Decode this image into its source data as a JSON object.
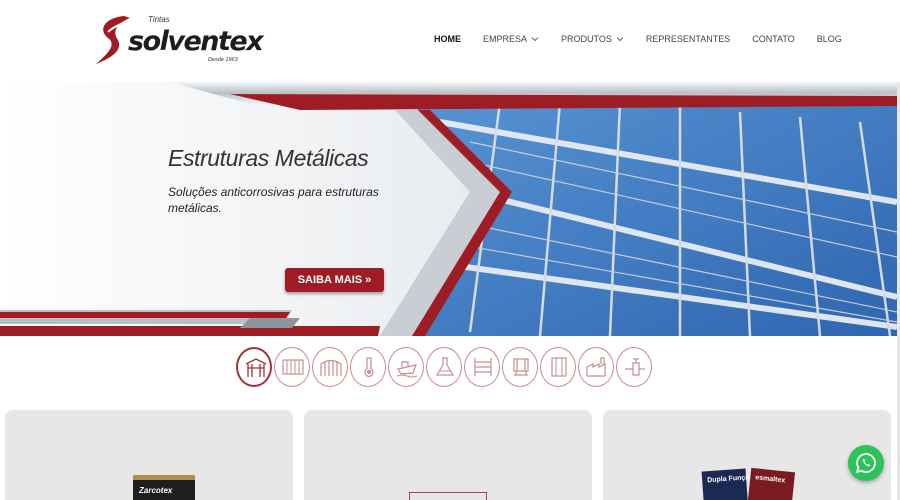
{
  "logo": {
    "pre": "Tintas",
    "brand": "solventex",
    "since": "Desde 1963"
  },
  "nav": [
    {
      "label": "HOME",
      "active": true,
      "dropdown": false
    },
    {
      "label": "EMPRESA",
      "active": false,
      "dropdown": true
    },
    {
      "label": "PRODUTOS",
      "active": false,
      "dropdown": true
    },
    {
      "label": "REPRESENTANTES",
      "active": false,
      "dropdown": false
    },
    {
      "label": "CONTATO",
      "active": false,
      "dropdown": false
    },
    {
      "label": "BLOG",
      "active": false,
      "dropdown": false
    }
  ],
  "hero": {
    "title": "Estruturas Metálicas",
    "subtitle": "Soluções anticorrosivas para estruturas metálicas.",
    "button": "SAIBA MAIS »"
  },
  "categories": [
    {
      "icon": "steel-structure-icon",
      "active": true
    },
    {
      "icon": "container-icon",
      "active": false
    },
    {
      "icon": "gate-icon",
      "active": false
    },
    {
      "icon": "thermometer-icon",
      "active": false
    },
    {
      "icon": "ship-icon",
      "active": false
    },
    {
      "icon": "lab-flask-icon",
      "active": false
    },
    {
      "icon": "shelving-icon",
      "active": false
    },
    {
      "icon": "machine-icon",
      "active": false
    },
    {
      "icon": "tank-icon",
      "active": false
    },
    {
      "icon": "factory-icon",
      "active": false
    },
    {
      "icon": "pipe-valve-icon",
      "active": false
    }
  ],
  "cards": {
    "card1_label": "Zarcotex",
    "card3_labels": [
      "Dupla Função",
      "esmaltex"
    ]
  },
  "colors": {
    "brand_red": "#9e1d25",
    "icon_ring": "#c98c91",
    "sky_blue": "#3f7fc4",
    "whatsapp_green": "#2ec25a"
  }
}
